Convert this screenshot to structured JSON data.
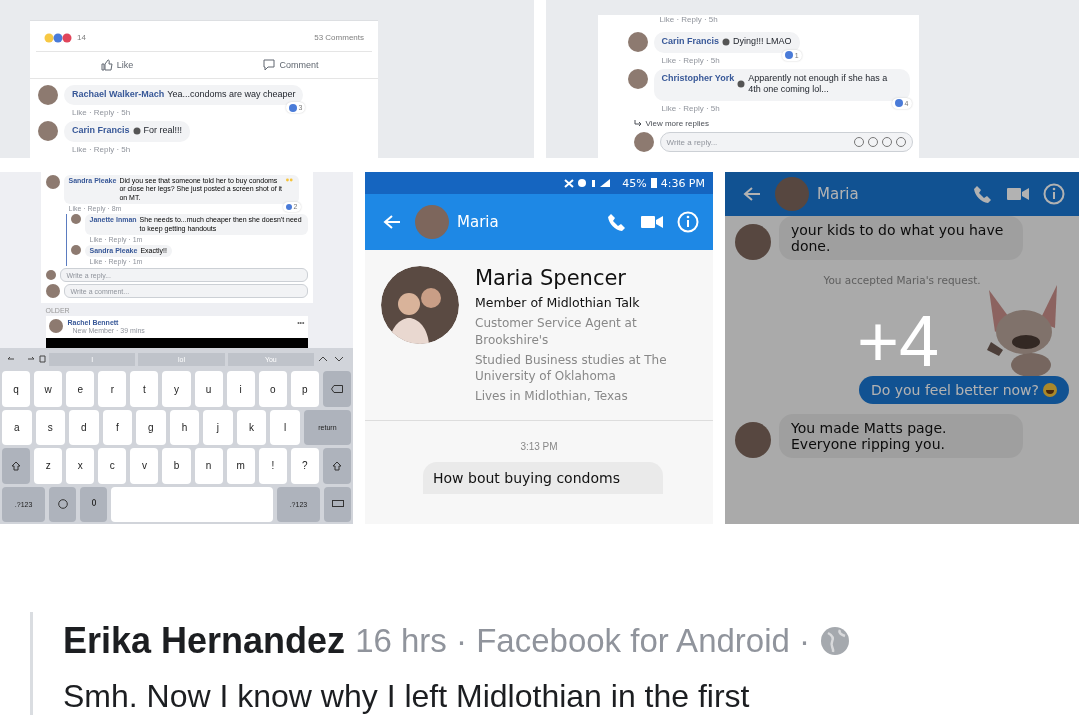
{
  "photo_grid": {
    "tiles": [
      {
        "kind": "fb_post",
        "reaction_count": "14",
        "comments_count": "53 Comments",
        "actions": [
          {
            "kind": "like",
            "label": "Like"
          },
          {
            "kind": "comment",
            "label": "Comment"
          }
        ],
        "comments": [
          {
            "author": "Rachael Walker-Mach",
            "text": "Yea...condoms are way cheaper",
            "meta": "Like · Reply · 5h",
            "reaction_count": "3"
          },
          {
            "author": "Carin Francis",
            "badge": true,
            "text": "For real!!!",
            "meta": "Like · Reply · 5h"
          }
        ]
      },
      {
        "kind": "fb_replies",
        "top_meta": "Like · Reply · 5h",
        "comments": [
          {
            "author": "Carin Francis",
            "badge": true,
            "text": "Dying!!! LMAO",
            "meta": "Like · Reply · 5h",
            "reaction_count": "1"
          },
          {
            "author": "Christopher York",
            "badge": true,
            "text": "Apparently not enough if she has a 4th one coming lol...",
            "meta": "Like · Reply · 5h",
            "reaction_count": "4"
          }
        ],
        "more": "View more replies",
        "reply_placeholder": "Write a reply..."
      },
      {
        "kind": "fb_keyboard",
        "comments": [
          {
            "author": "Sandra Pleake",
            "text": "Did you see that someone told her to buy condoms or close her legs? She just posted a screen shot of it on MT.",
            "meta": "Like · Reply · 8m",
            "reaction_count": "2",
            "replies": [
              {
                "author": "Janette Inman",
                "text": "She needs to...much cheaper then she doesn't need to keep getting handouts",
                "meta": "Like · Reply · 1m"
              },
              {
                "author": "Sandra Pleake",
                "text": "Exactly!!",
                "meta": "Like · Reply · 1m"
              }
            ]
          }
        ],
        "reply_placeholder": "Write a reply...",
        "comment_placeholder": "Write a comment...",
        "section": "OLDER",
        "post": {
          "author": "Rachel Bennett",
          "meta": "New Member · 39 mins",
          "menu": "•••"
        },
        "suggestions": [
          "I",
          "lol",
          "You"
        ],
        "keys": [
          [
            {
              "kind": "char",
              "label": "q"
            },
            {
              "kind": "char",
              "label": "w"
            },
            {
              "kind": "char",
              "label": "e"
            },
            {
              "kind": "char",
              "label": "r"
            },
            {
              "kind": "char",
              "label": "t"
            },
            {
              "kind": "char",
              "label": "y"
            },
            {
              "kind": "char",
              "label": "u"
            },
            {
              "kind": "char",
              "label": "i"
            },
            {
              "kind": "char",
              "label": "o"
            },
            {
              "kind": "char",
              "label": "p"
            },
            {
              "kind": "backspace"
            }
          ],
          [
            {
              "kind": "char",
              "label": "a"
            },
            {
              "kind": "char",
              "label": "s"
            },
            {
              "kind": "char",
              "label": "d"
            },
            {
              "kind": "char",
              "label": "f"
            },
            {
              "kind": "char",
              "label": "g"
            },
            {
              "kind": "char",
              "label": "h"
            },
            {
              "kind": "char",
              "label": "j"
            },
            {
              "kind": "char",
              "label": "k"
            },
            {
              "kind": "char",
              "label": "l"
            },
            {
              "kind": "wide",
              "label": "return"
            }
          ],
          [
            {
              "kind": "shift"
            },
            {
              "kind": "char",
              "label": "z"
            },
            {
              "kind": "char",
              "label": "x"
            },
            {
              "kind": "char",
              "label": "c"
            },
            {
              "kind": "char",
              "label": "v"
            },
            {
              "kind": "char",
              "label": "b"
            },
            {
              "kind": "char",
              "label": "n"
            },
            {
              "kind": "char",
              "label": "m"
            },
            {
              "kind": "char",
              "label": "!"
            },
            {
              "kind": "char",
              "label": "?"
            },
            {
              "kind": "shift"
            }
          ],
          [
            {
              "kind": "mode",
              "label": ".?123"
            },
            {
              "kind": "emoji"
            },
            {
              "kind": "mic"
            },
            {
              "kind": "space"
            },
            {
              "kind": "mode",
              "label": ".?123"
            },
            {
              "kind": "hide"
            }
          ]
        ]
      },
      {
        "kind": "messenger_profile",
        "battery": "45%",
        "clock": "4:36 PM",
        "contact": "Maria",
        "name": "Maria Spencer",
        "group": "Member of Midlothian Talk",
        "details": [
          "Customer Service Agent at Brookshire's",
          "Studied Business studies at The University of Oklahoma",
          "Lives in Midlothian, Texas"
        ],
        "time": "3:13 PM",
        "message": "How bout buying condoms"
      },
      {
        "kind": "messenger_chat",
        "contact": "Maria",
        "messages": [
          {
            "kind": "in",
            "text": "your kids to do what you have done."
          },
          {
            "kind": "notice",
            "text": "You accepted Maria's request."
          },
          {
            "kind": "sticker"
          },
          {
            "kind": "out",
            "text": "Do you feel better now?"
          },
          {
            "kind": "in",
            "text": "You made Matts page. Everyone ripping you."
          }
        ],
        "more_count": "+4"
      }
    ]
  },
  "post": {
    "author": "Erika Hernandez",
    "meta": "16 hrs · Facebook for Android ·",
    "text": "Smh. Now I know why I left Midlothian in the first"
  }
}
